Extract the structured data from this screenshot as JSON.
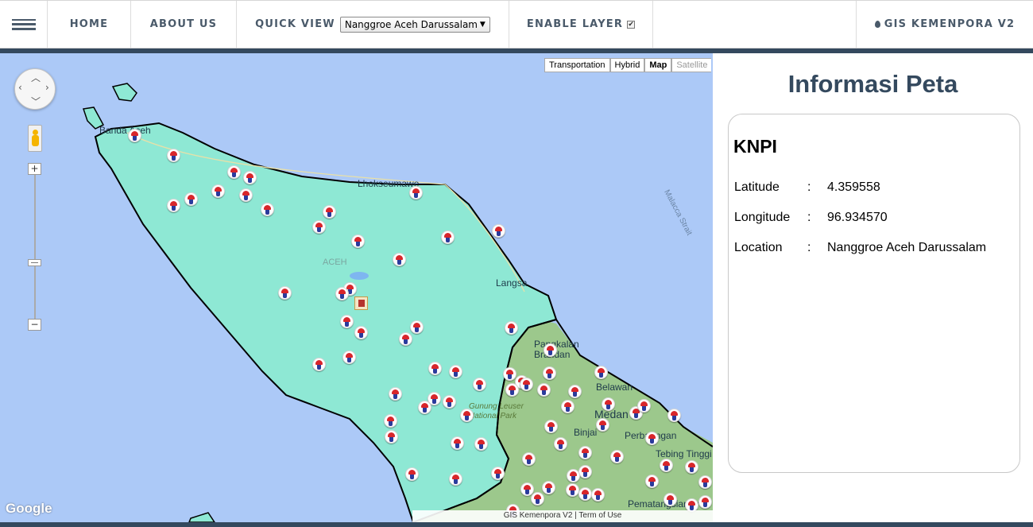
{
  "nav": {
    "home": "HOME",
    "about": "ABOUT US",
    "quick_view_label": "QUICK VIEW",
    "quick_view_selected": "Nanggroe Aceh Darussalam",
    "enable_layer_label": "ENABLE LAYER",
    "enable_layer_checked": "✔",
    "brand": "GIS KEMENPORA V2"
  },
  "map": {
    "type_buttons": [
      "Transportation",
      "Hybrid",
      "Map",
      "Satellite"
    ],
    "active_type": "Map",
    "labels": {
      "banda_aceh": "Banda Aceh",
      "lhokseumawe": "Lhokseumawe",
      "aceh": "ACEH",
      "langsa": "Langsa",
      "pangkalan_brandan": "Pangkalan Brandan",
      "belawan": "Belawan",
      "medan": "Medan",
      "binjai": "Binjai",
      "perbaungan": "Perbaungan",
      "tebing_tinggi": "Tebing Tinggi",
      "pematangsiantar": "Pematangsiantar",
      "gunung_leuser": "Gunung Leuser National Park",
      "malacca_strait": "Malacca Strait"
    },
    "google_logo": "Google",
    "footer": "GIS Kemenpora V2 | Term of Use",
    "colors": {
      "water": "#acc9f7",
      "aceh_land": "#8ee8d4",
      "north_sumatra_land": "#9ac58a",
      "border": "#000000"
    }
  },
  "info": {
    "title": "Informasi Peta",
    "card_title": "KNPI",
    "rows": [
      {
        "key": "Latitude",
        "sep": ":",
        "value": "4.359558"
      },
      {
        "key": "Longitude",
        "sep": ":",
        "value": "96.934570"
      },
      {
        "key": "Location",
        "sep": ":",
        "value": "Nanggroe Aceh Darussalam"
      }
    ]
  }
}
